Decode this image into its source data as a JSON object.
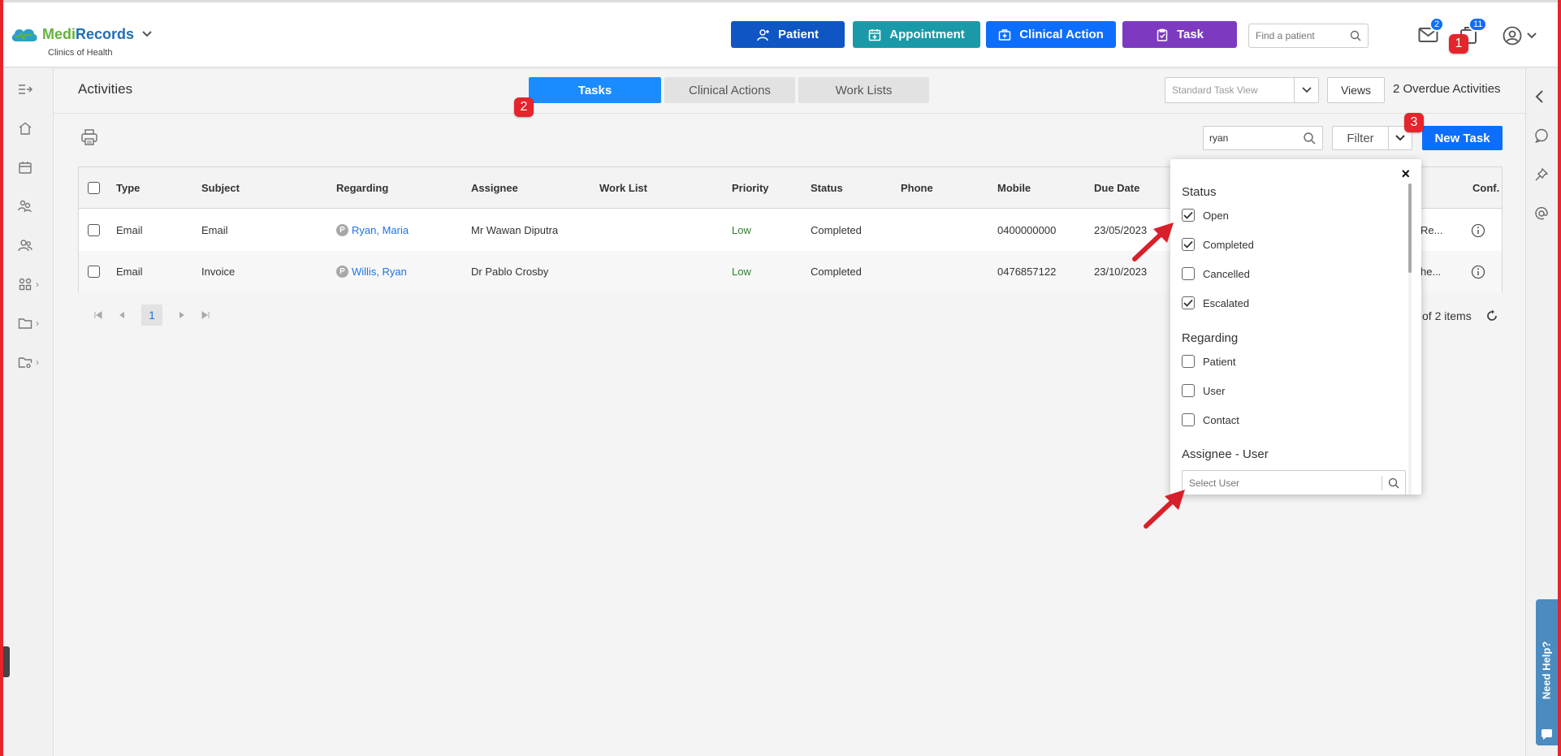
{
  "brand": {
    "name_a": "Medi",
    "name_b": "Records",
    "clinic": "Clinics of Health"
  },
  "header": {
    "buttons": {
      "patient": "Patient",
      "appointment": "Appointment",
      "clinical_action": "Clinical Action",
      "task": "Task"
    },
    "find_placeholder": "Find a patient",
    "mail_count": "2",
    "notif_count": "11"
  },
  "markers": {
    "one": "1",
    "two": "2",
    "three": "3"
  },
  "page": {
    "title": "Activities",
    "tabs": [
      "Tasks",
      "Clinical Actions",
      "Work Lists"
    ],
    "view_select": "Standard Task View",
    "views_label": "Views",
    "overdue": "2 Overdue Activities",
    "search_value": "ryan",
    "filter_label": "Filter",
    "new_task_label": "New Task"
  },
  "table": {
    "columns": [
      "Type",
      "Subject",
      "Regarding",
      "Assignee",
      "Work List",
      "Priority",
      "Status",
      "Phone",
      "Mobile",
      "Due Date",
      "Conf."
    ],
    "rows": [
      {
        "type": "Email",
        "subject": "Email",
        "regarding": "Ryan, Maria",
        "assignee": "Mr Wawan Diputra",
        "work_list": "",
        "priority": "Low",
        "status": "Completed",
        "phone": "",
        "mobile": "0400000000",
        "due": "23/05/2023",
        "extra": "Re..."
      },
      {
        "type": "Email",
        "subject": "Invoice",
        "regarding": "Willis, Ryan",
        "assignee": "Dr Pablo Crosby",
        "work_list": "",
        "priority": "Low",
        "status": "Completed",
        "phone": "",
        "mobile": "0476857122",
        "due": "23/10/2023",
        "extra": "he..."
      }
    ],
    "regarding_badge": "P"
  },
  "pager": {
    "page": "1",
    "items_text": "of 2 items"
  },
  "filter_popup": {
    "close": "×",
    "status_heading": "Status",
    "status": [
      {
        "label": "Open",
        "checked": true
      },
      {
        "label": "Completed",
        "checked": true
      },
      {
        "label": "Cancelled",
        "checked": false
      },
      {
        "label": "Escalated",
        "checked": true
      }
    ],
    "regarding_heading": "Regarding",
    "regarding": [
      {
        "label": "Patient",
        "checked": false
      },
      {
        "label": "User",
        "checked": false
      },
      {
        "label": "Contact",
        "checked": false
      }
    ],
    "assignee_heading": "Assignee - User",
    "select_user_placeholder": "Select User"
  },
  "help": {
    "label": "Need Help?"
  },
  "colors": {
    "primary": "#0d6efd",
    "patient": "#0f55c4",
    "appointment": "#1a9aa8",
    "task": "#7d3ac1",
    "marker": "#e5242b",
    "low": "#2e7d32"
  }
}
